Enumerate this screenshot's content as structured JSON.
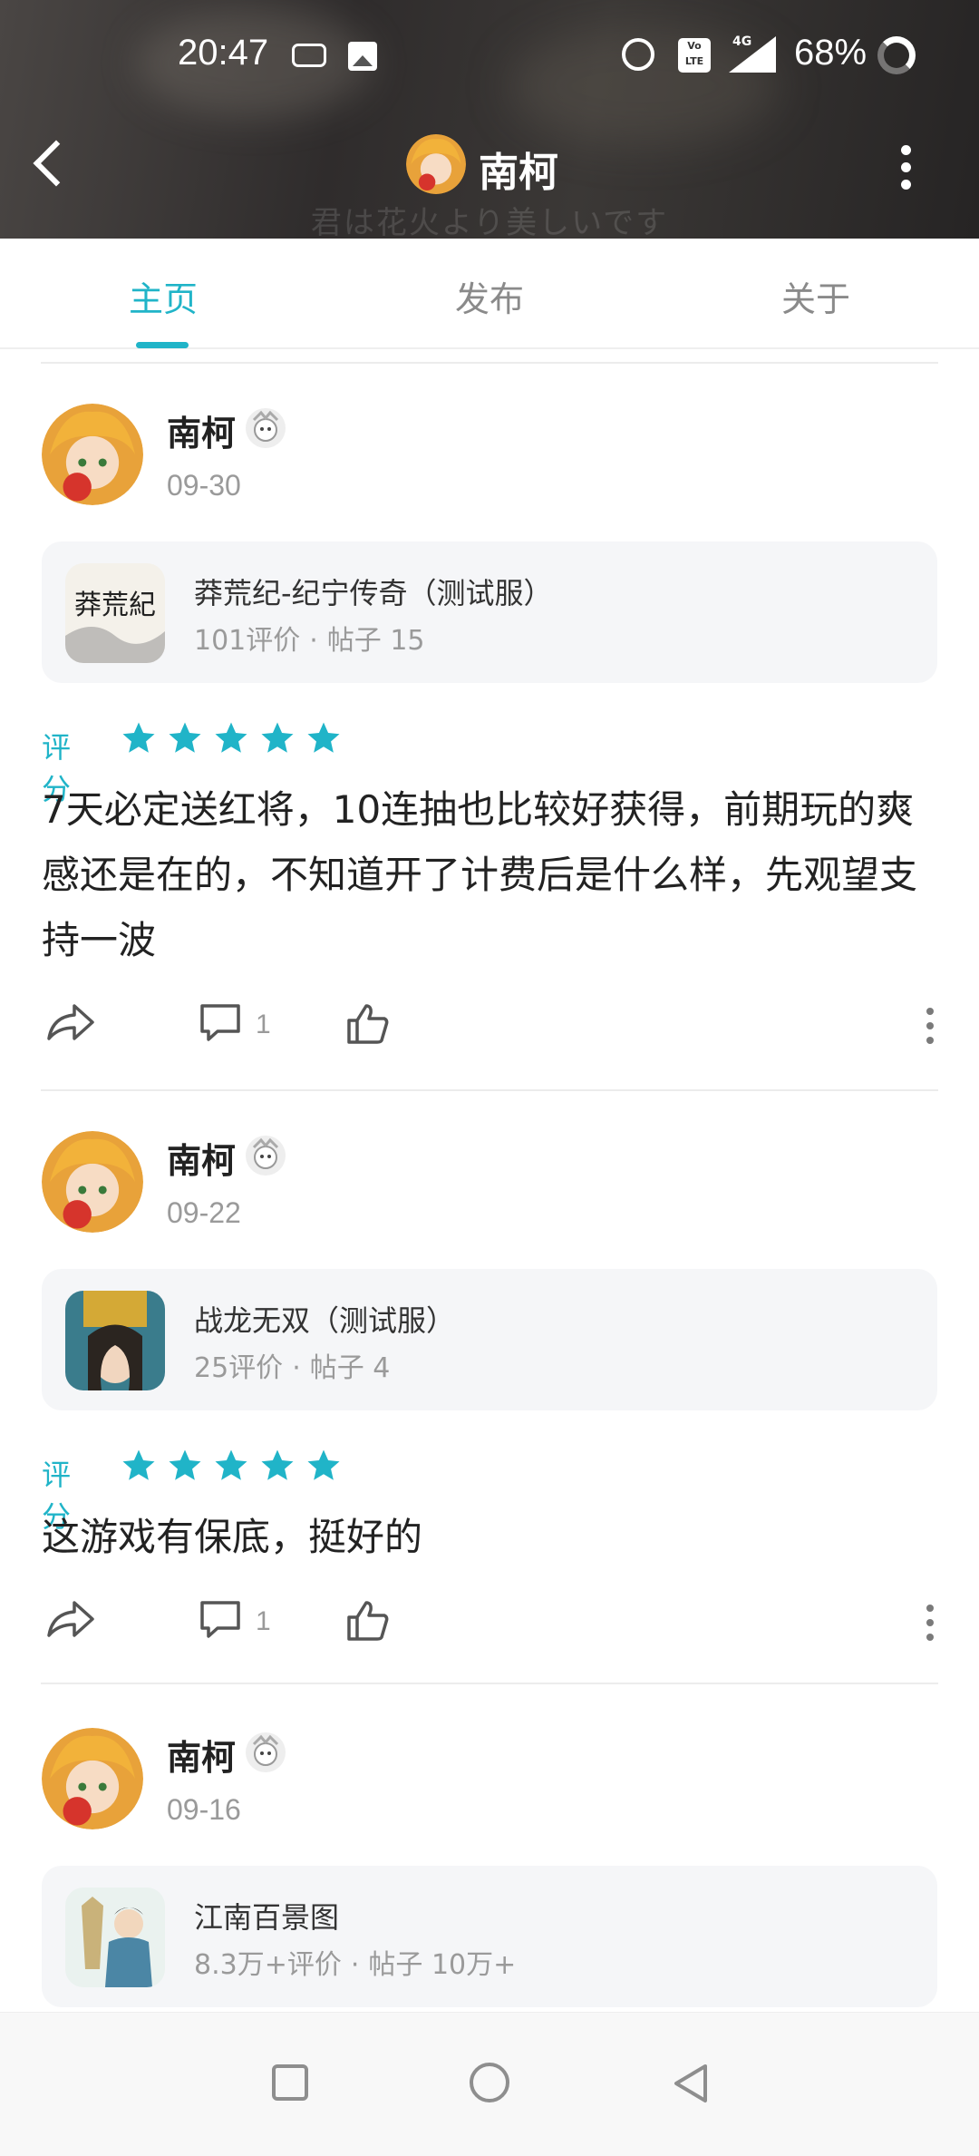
{
  "status_bar": {
    "time": "20:47",
    "network": "4G",
    "volte": "Vo LTE",
    "battery": "68%"
  },
  "header": {
    "title": "南柯",
    "watermark": "君は花火より美しいです"
  },
  "tabs": [
    {
      "label": "主页",
      "active": true
    },
    {
      "label": "发布",
      "active": false
    },
    {
      "label": "关于",
      "active": false
    }
  ],
  "posts": [
    {
      "user": "南柯",
      "date": "09-30",
      "game": {
        "name": "莽荒纪-纪宁传奇（测试服）",
        "reviews": "101评价",
        "posts": "帖子 15",
        "icon_text": "莽荒紀"
      },
      "rating_label": "评分",
      "rating": 5,
      "content": "7天必定送红将，10连抽也比较好获得，前期玩的爽感还是在的，不知道开了计费后是什么样，先观望支持一波",
      "comment_count": "1"
    },
    {
      "user": "南柯",
      "date": "09-22",
      "game": {
        "name": "战龙无双（测试服）",
        "reviews": "25评价",
        "posts": "帖子 4"
      },
      "rating_label": "评分",
      "rating": 5,
      "content": "这游戏有保底，挺好的",
      "comment_count": "1"
    },
    {
      "user": "南柯",
      "date": "09-16",
      "game": {
        "name": "江南百景图",
        "reviews": "8.3万+评价",
        "posts": "帖子 10万+"
      }
    }
  ],
  "colors": {
    "accent": "#20b4c8",
    "star": "#20b4c8"
  }
}
